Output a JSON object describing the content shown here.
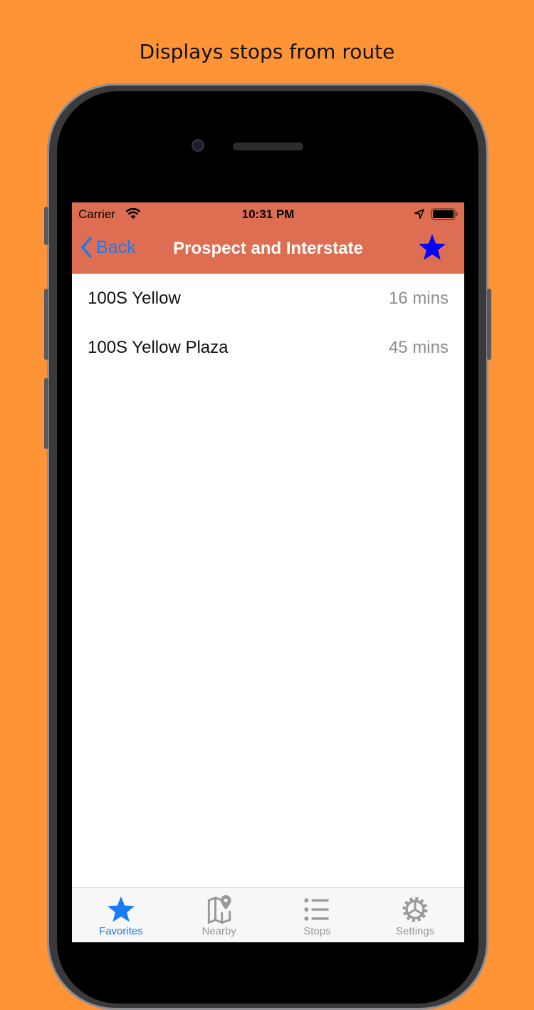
{
  "caption": "Displays stops from route",
  "status_bar": {
    "carrier": "Carrier",
    "time": "10:31 PM"
  },
  "nav": {
    "back_label": "Back",
    "title": "Prospect and Interstate"
  },
  "stops": [
    {
      "name": "100S Yellow",
      "time": "16 mins"
    },
    {
      "name": "100S Yellow Plaza",
      "time": "45 mins"
    }
  ],
  "tabs": [
    {
      "label": "Favorites",
      "icon": "star-icon",
      "active": true
    },
    {
      "label": "Nearby",
      "icon": "map-pin-icon"
    },
    {
      "label": "Stops",
      "icon": "list-icon"
    },
    {
      "label": "Settings",
      "icon": "gear-icon"
    }
  ],
  "colors": {
    "background": "#FF9437",
    "header": "#DD6E52",
    "accent": "#1A7CF5",
    "favorite_star": "#0000FF"
  }
}
